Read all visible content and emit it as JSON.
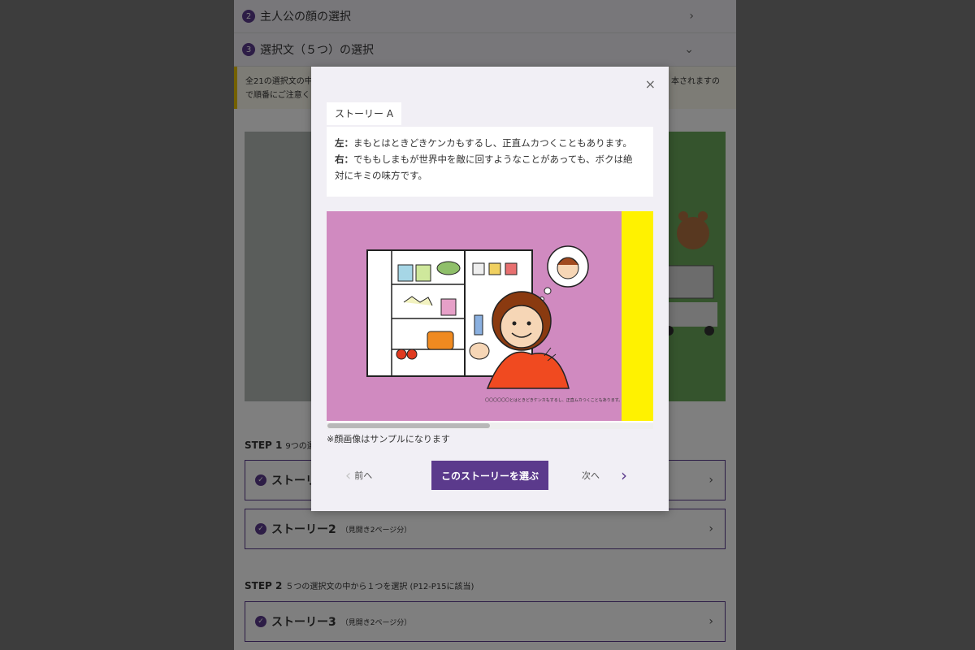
{
  "background": {
    "accordion": [
      {
        "num": "2",
        "label": "主人公の顔の選択",
        "chevron": "›"
      },
      {
        "num": "3",
        "label": "選択文（５つ）の選択",
        "chevron": "⌄"
      }
    ],
    "notice": {
      "line1": "全21の選択文の中",
      "line2": "で順番にご注意く",
      "tail": "本されますの"
    },
    "step1": {
      "title": "STEP 1",
      "sub": "9つの選"
    },
    "step2": {
      "title": "STEP 2",
      "sub": "５つの選択文の中から１つを選択 (P12-P15に該当)"
    },
    "stories": [
      {
        "name": "ストーリ",
        "small": ""
      },
      {
        "name": "ストーリー2",
        "small": "（見開き2ページ分）"
      },
      {
        "name": "ストーリー3",
        "small": "（見開き2ページ分）"
      }
    ]
  },
  "modal": {
    "close": "×",
    "tab": "ストーリー A",
    "left_label": "左：",
    "left_text": "まもとはときどきケンカもするし、正直ムカつくこともあります。",
    "right_label": "右：",
    "right_text_1": "でももしまもが世界中を敵に回すようなことがあっても、ボクは絶",
    "right_text_2": "対にキミの味方です。",
    "caption": "〇〇〇〇〇〇とはときどきケンカもするし、正直ムカつくこともあります。",
    "note": "※顔画像はサンプルになります",
    "prev": "前へ",
    "choose": "このストーリーを選ぶ",
    "next": "次へ"
  },
  "colors": {
    "accent": "#5b3a8c",
    "illustration_bg": "#d08ac0",
    "side_strip": "#fff200"
  },
  "icons": [
    "close-icon",
    "chevron-left-icon",
    "chevron-right-icon",
    "check-icon"
  ]
}
